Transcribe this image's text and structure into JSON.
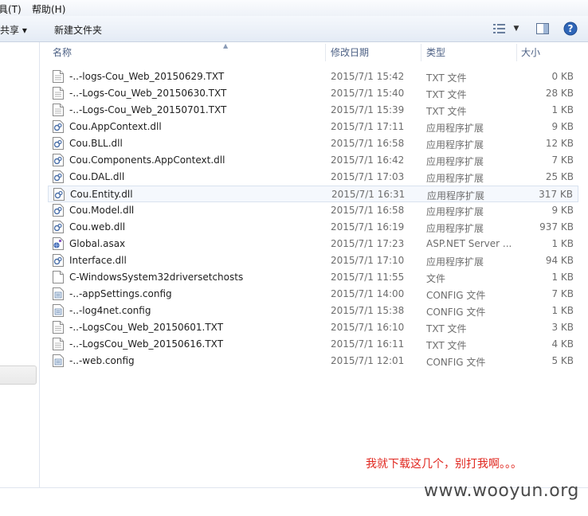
{
  "menu": {
    "tools": "具(T)",
    "help": "帮助(H)"
  },
  "toolbar": {
    "share": "共享 ▾",
    "new_folder": "新建文件夹"
  },
  "columns": {
    "name": "名称",
    "date": "修改日期",
    "type": "类型",
    "size": "大小"
  },
  "files": [
    {
      "name": "-..-logs-Cou_Web_20150629.TXT",
      "date": "2015/7/1 15:42",
      "type": "TXT 文件",
      "size": "0 KB",
      "icon": "text-file-icon"
    },
    {
      "name": "-..-Logs-Cou_Web_20150630.TXT",
      "date": "2015/7/1 15:40",
      "type": "TXT 文件",
      "size": "28 KB",
      "icon": "text-file-icon"
    },
    {
      "name": "-..-Logs-Cou_Web_20150701.TXT",
      "date": "2015/7/1 15:39",
      "type": "TXT 文件",
      "size": "1 KB",
      "icon": "text-file-icon"
    },
    {
      "name": "Cou.AppContext.dll",
      "date": "2015/7/1 17:11",
      "type": "应用程序扩展",
      "size": "9 KB",
      "icon": "dll-file-icon"
    },
    {
      "name": "Cou.BLL.dll",
      "date": "2015/7/1 16:58",
      "type": "应用程序扩展",
      "size": "12 KB",
      "icon": "dll-file-icon"
    },
    {
      "name": "Cou.Components.AppContext.dll",
      "date": "2015/7/1 16:42",
      "type": "应用程序扩展",
      "size": "7 KB",
      "icon": "dll-file-icon"
    },
    {
      "name": "Cou.DAL.dll",
      "date": "2015/7/1 17:03",
      "type": "应用程序扩展",
      "size": "25 KB",
      "icon": "dll-file-icon"
    },
    {
      "name": "Cou.Entity.dll",
      "date": "2015/7/1 16:31",
      "type": "应用程序扩展",
      "size": "317 KB",
      "icon": "dll-file-icon"
    },
    {
      "name": "Cou.Model.dll",
      "date": "2015/7/1 16:58",
      "type": "应用程序扩展",
      "size": "9 KB",
      "icon": "dll-file-icon"
    },
    {
      "name": "Cou.web.dll",
      "date": "2015/7/1 16:19",
      "type": "应用程序扩展",
      "size": "937 KB",
      "icon": "dll-file-icon"
    },
    {
      "name": "Global.asax",
      "date": "2015/7/1 17:23",
      "type": "ASP.NET Server ...",
      "size": "1 KB",
      "icon": "asax-file-icon"
    },
    {
      "name": "Interface.dll",
      "date": "2015/7/1 17:10",
      "type": "应用程序扩展",
      "size": "94 KB",
      "icon": "dll-file-icon"
    },
    {
      "name": "C-WindowsSystem32driversetchosts",
      "date": "2015/7/1 11:55",
      "type": "文件",
      "size": "1 KB",
      "icon": "blank-file-icon"
    },
    {
      "name": "-..-appSettings.config",
      "date": "2015/7/1 14:00",
      "type": "CONFIG 文件",
      "size": "7 KB",
      "icon": "config-file-icon"
    },
    {
      "name": "-..-log4net.config",
      "date": "2015/7/1 15:38",
      "type": "CONFIG 文件",
      "size": "1 KB",
      "icon": "config-file-icon"
    },
    {
      "name": "-..-LogsCou_Web_20150601.TXT",
      "date": "2015/7/1 16:10",
      "type": "TXT 文件",
      "size": "3 KB",
      "icon": "text-file-icon"
    },
    {
      "name": "-..-LogsCou_Web_20150616.TXT",
      "date": "2015/7/1 16:11",
      "type": "TXT 文件",
      "size": "4 KB",
      "icon": "text-file-icon"
    },
    {
      "name": "-..-web.config",
      "date": "2015/7/1 12:01",
      "type": "CONFIG 文件",
      "size": "5 KB",
      "icon": "config-file-icon"
    }
  ],
  "selected_index": 7,
  "annotation": "我就下载这几个，别打我啊。。。",
  "watermark": "www.wooyun.org",
  "colors": {
    "annotation": "#e0271f",
    "header_text": "#4d6185",
    "selection_bg": "#f5f8fd"
  }
}
